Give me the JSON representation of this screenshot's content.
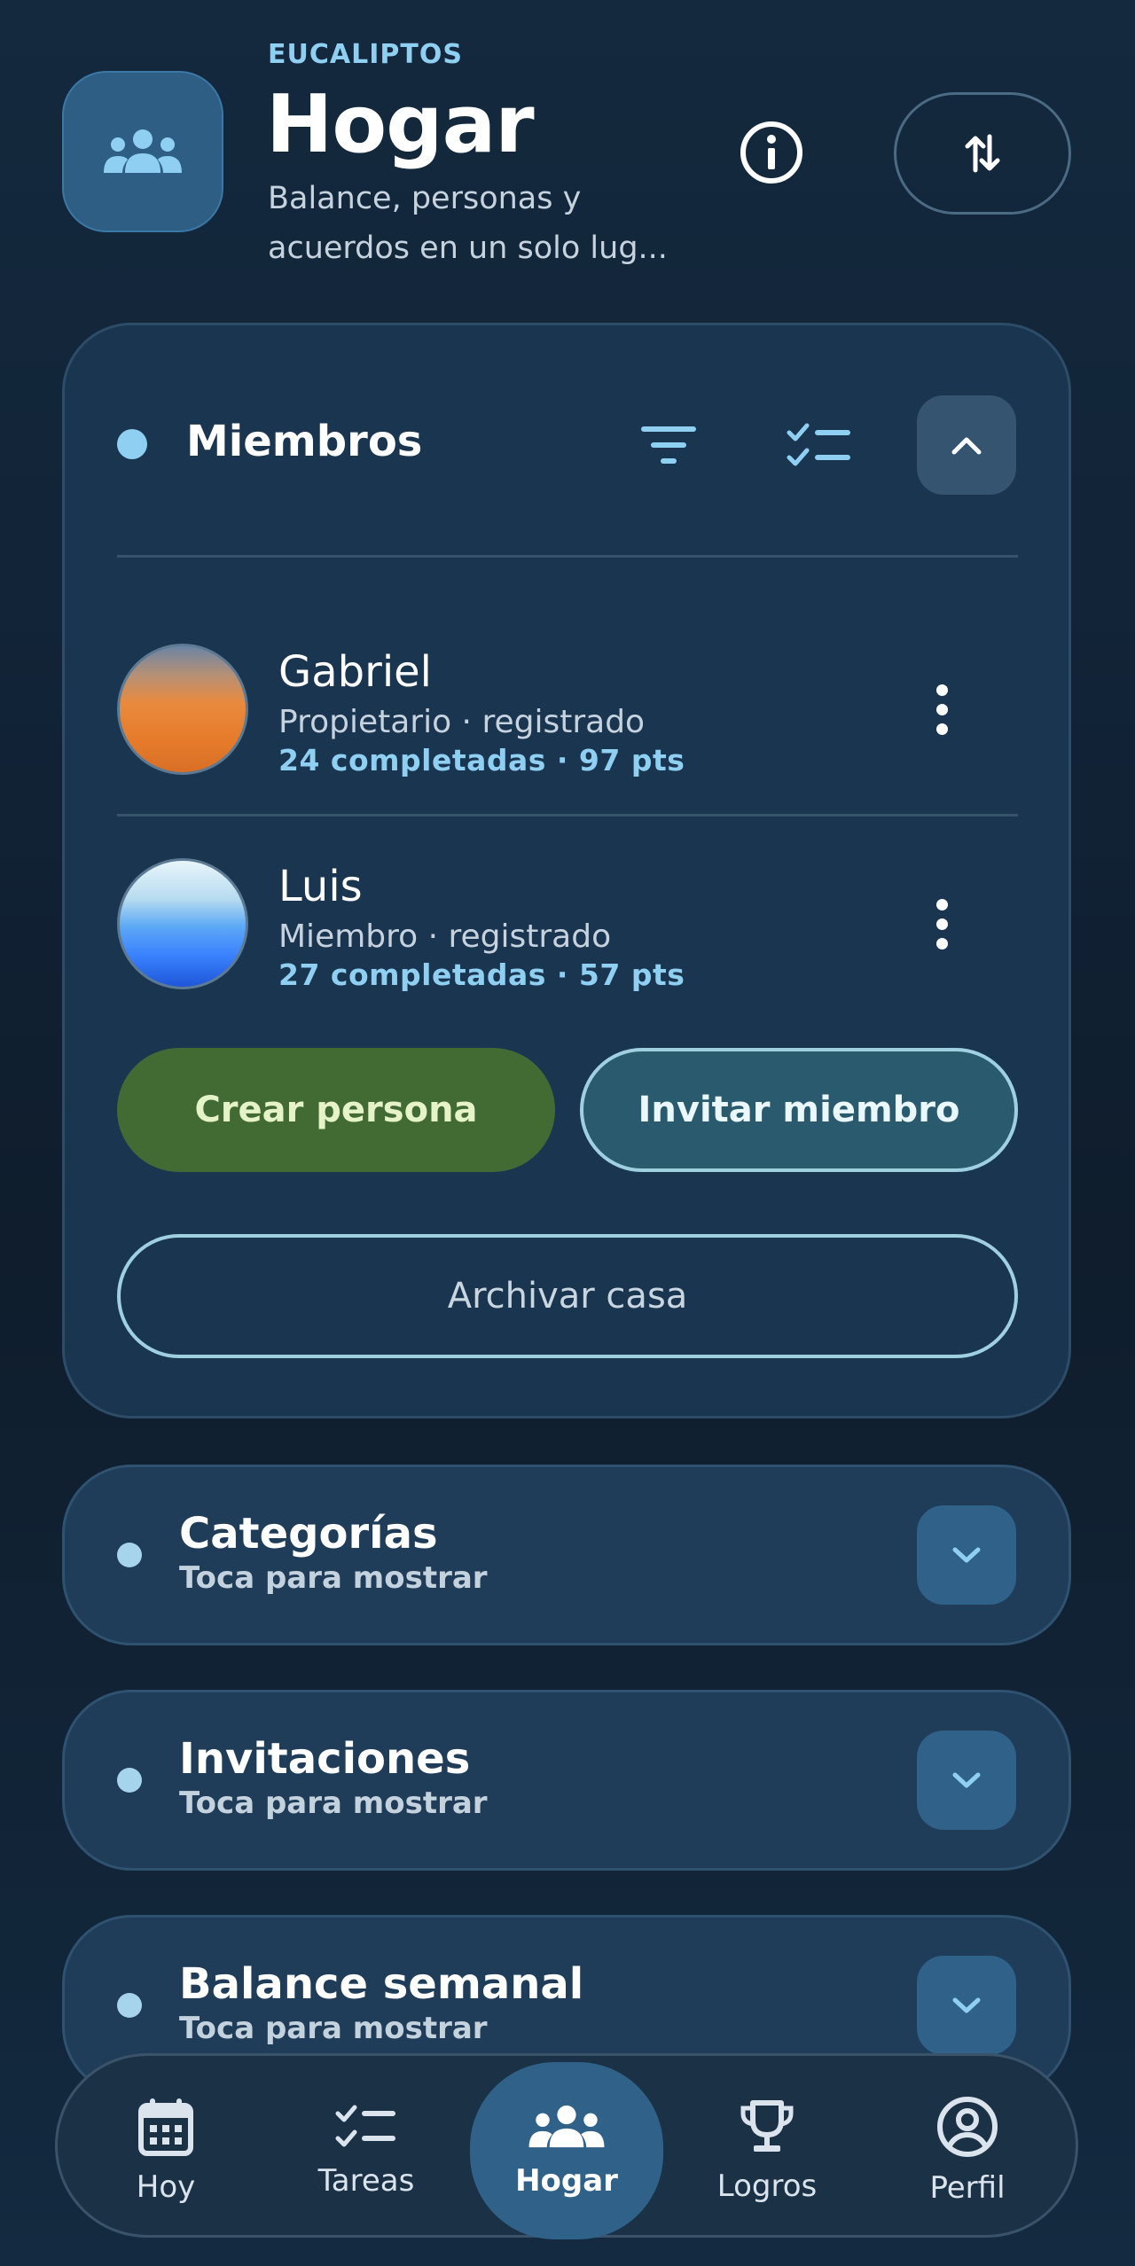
{
  "header": {
    "eyebrow": "EUCALIPTOS",
    "title": "Hogar",
    "subtitle": "Balance, personas y acuerdos en un solo lug..."
  },
  "members": {
    "title": "Miembros",
    "list": [
      {
        "name": "Gabriel",
        "role": "Propietario · registrado",
        "stats": "24 completadas · 97 pts"
      },
      {
        "name": "Luis",
        "role": "Miembro · registrado",
        "stats": "27 completadas · 57 pts"
      }
    ],
    "create_label": "Crear persona",
    "invite_label": "Invitar miembro",
    "archive_label": "Archivar casa"
  },
  "sections": [
    {
      "title": "Categorías",
      "subtitle": "Toca para mostrar"
    },
    {
      "title": "Invitaciones",
      "subtitle": "Toca para mostrar"
    },
    {
      "title": "Balance semanal",
      "subtitle": "Toca para mostrar"
    }
  ],
  "nav": [
    {
      "label": "Hoy",
      "icon": "calendar-icon"
    },
    {
      "label": "Tareas",
      "icon": "checklist-icon"
    },
    {
      "label": "Hogar",
      "icon": "group-icon",
      "active": true
    },
    {
      "label": "Logros",
      "icon": "trophy-icon"
    },
    {
      "label": "Perfil",
      "icon": "account-circle-icon"
    }
  ],
  "colors": {
    "accent": "#8fd0f2",
    "primary_button": "#426b34",
    "surface": "#1a3550"
  }
}
